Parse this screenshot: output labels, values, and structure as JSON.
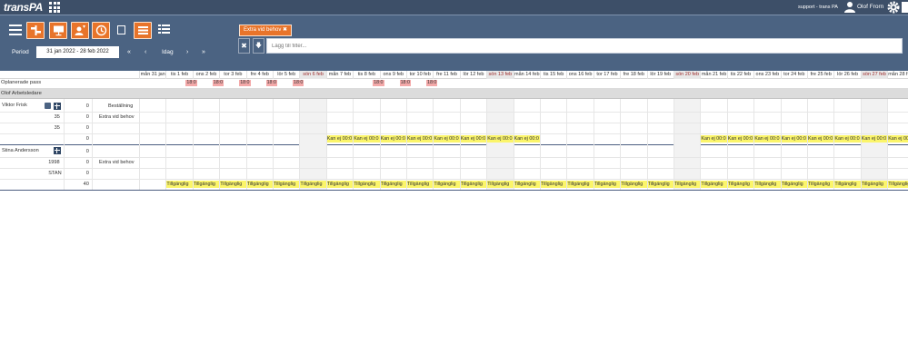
{
  "app": {
    "logo": "transPA",
    "support": "support - trans PA",
    "user": "Olof Frorn"
  },
  "toolbar": {
    "period_label": "Period",
    "period_value": "31 jan 2022 - 28 feb 2022",
    "today": "Idag",
    "first": "«",
    "prev": "‹",
    "next": "›",
    "last": "»",
    "active_filter": "Extra vid behov ✖",
    "filter_placeholder": "Lägg till filter..."
  },
  "days": [
    {
      "label": "mån 31 jan",
      "we": false
    },
    {
      "label": "tis 1 feb",
      "we": false
    },
    {
      "label": "ons 2 feb",
      "we": false
    },
    {
      "label": "tor 3 feb",
      "we": false
    },
    {
      "label": "fre 4 feb",
      "we": false
    },
    {
      "label": "lör 5 feb",
      "we": false
    },
    {
      "label": "sön 6 feb",
      "we": true
    },
    {
      "label": "mån 7 feb",
      "we": false
    },
    {
      "label": "tis 8 feb",
      "we": false
    },
    {
      "label": "ons 9 feb",
      "we": false
    },
    {
      "label": "tor 10 feb",
      "we": false
    },
    {
      "label": "fre 11 feb",
      "we": false
    },
    {
      "label": "lör 12 feb",
      "we": false
    },
    {
      "label": "sön 13 feb",
      "we": true
    },
    {
      "label": "mån 14 feb",
      "we": false
    },
    {
      "label": "tis 15 feb",
      "we": false
    },
    {
      "label": "ons 16 feb",
      "we": false
    },
    {
      "label": "tor 17 feb",
      "we": false
    },
    {
      "label": "fre 18 feb",
      "we": false
    },
    {
      "label": "lör 19 feb",
      "we": false
    },
    {
      "label": "sön 20 feb",
      "we": true
    },
    {
      "label": "mån 21 feb",
      "we": false
    },
    {
      "label": "tis 22 feb",
      "we": false
    },
    {
      "label": "ons 23 feb",
      "we": false
    },
    {
      "label": "tor 24 feb",
      "we": false
    },
    {
      "label": "fre 25 feb",
      "we": false
    },
    {
      "label": "lör 26 feb",
      "we": false
    },
    {
      "label": "sön 27 feb",
      "we": true
    },
    {
      "label": "mån 28 feb",
      "we": false
    }
  ],
  "unplanned": {
    "label": "Oplanerade pass",
    "value": "18:0",
    "days": [
      1,
      2,
      3,
      4,
      5,
      8,
      9,
      10
    ]
  },
  "group": {
    "label": "Olof Arbetsledare"
  },
  "persons": [
    {
      "name": "Viktor Frisk",
      "rows": [
        {
          "c1": "",
          "c2": "0",
          "c3": "Beställning"
        },
        {
          "c1": "35",
          "c2": "0",
          "c3": "Extra vid behov"
        },
        {
          "c1": "35",
          "c2": "0",
          "c3": ""
        },
        {
          "c1": "",
          "c2": "0",
          "c3": ""
        }
      ],
      "status": "Kan ej 00:0",
      "status_days": [
        7,
        8,
        9,
        10,
        11,
        12,
        13,
        14,
        21,
        22,
        23,
        24,
        25,
        26,
        27,
        28
      ]
    },
    {
      "name": "Stina Andersson",
      "rows": [
        {
          "c1": "",
          "c2": "0",
          "c3": ""
        },
        {
          "c1": "1998",
          "c2": "0",
          "c3": "Extra vid behov"
        },
        {
          "c1": "STAN",
          "c2": "0",
          "c3": ""
        },
        {
          "c1": "",
          "c2": "40",
          "c3": ""
        }
      ],
      "status": "Tillgänglig",
      "status_days": [
        1,
        2,
        3,
        4,
        5,
        6,
        7,
        8,
        9,
        10,
        11,
        12,
        13,
        14,
        15,
        16,
        17,
        18,
        19,
        20,
        21,
        22,
        23,
        24,
        25,
        26,
        27,
        28
      ]
    }
  ],
  "colors": {
    "header": "#3d4f68",
    "toolbar": "#4b6382",
    "accent": "#e8742a",
    "status_yellow": "#fbf56a",
    "unplanned_pink": "#f4a9a9"
  }
}
